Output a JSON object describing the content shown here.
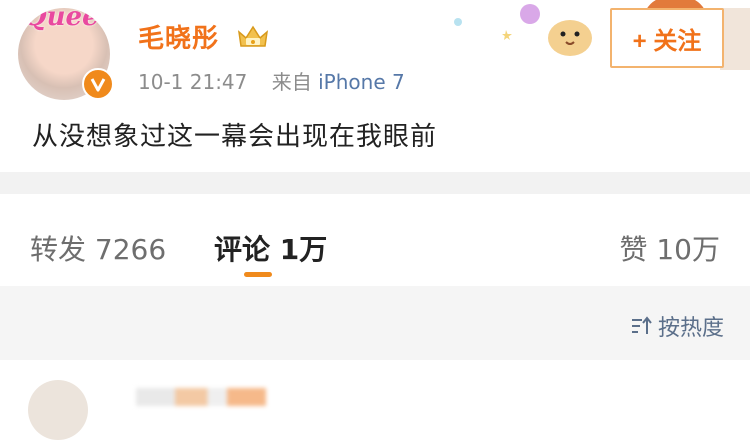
{
  "post": {
    "avatar_text": "Queen",
    "author": "毛晓彤",
    "time": "10-1 21:47",
    "source_prefix": "来自",
    "device": "iPhone 7",
    "follow_label": "+ 关注",
    "text": "从没想象过这一幕会出现在我眼前"
  },
  "tabs": {
    "repost_label": "转发 7266",
    "comments_label": "评论 1万",
    "likes_label": "赞 10万"
  },
  "sort": {
    "label": "按热度"
  },
  "colors": {
    "accent": "#f1721a",
    "link": "#5678a8",
    "band": "#f2f2f2"
  },
  "icons": {
    "verified": "verified-v-icon",
    "vip": "vip-crown-icon",
    "sort": "sort-icon"
  }
}
